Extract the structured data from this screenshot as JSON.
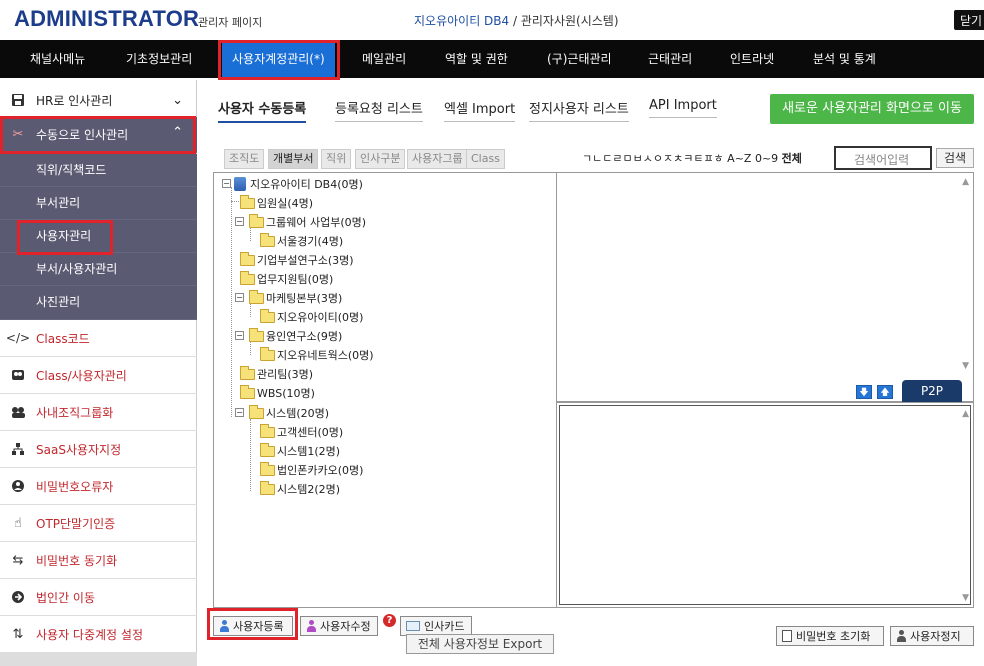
{
  "header": {
    "logo": "ADMINISTRATOR",
    "logo_sub": "관리자 페이지",
    "company": "지오유아이티 DB4",
    "separator": " / ",
    "user": "관리자사원(시스템)",
    "close_label": "닫기"
  },
  "topnav": {
    "items": [
      "채널사메뉴",
      "기초정보관리",
      "사용자계정관리(*)",
      "메일관리",
      "역할 및 권한",
      "(구)근태관리",
      "근태관리",
      "인트라넷",
      "분석 및 통계"
    ],
    "active_index": 2
  },
  "sidebar": {
    "hr": "HR로 인사관리",
    "manual": "수동으로 인사관리",
    "subitems": [
      "직위/직책코드",
      "부서관리",
      "사용자관리",
      "부서/사용자관리",
      "사진관리"
    ],
    "items": [
      {
        "label": "Class코드",
        "icon": "code-icon"
      },
      {
        "label": "Class/사용자관리",
        "icon": "users-icon"
      },
      {
        "label": "사내조직그룹화",
        "icon": "group-icon"
      },
      {
        "label": "SaaS사용자지정",
        "icon": "sitemap-icon"
      },
      {
        "label": "비밀번호오류자",
        "icon": "user-error-icon"
      },
      {
        "label": "OTP단말기인증",
        "icon": "hand-icon"
      },
      {
        "label": "비밀번호 동기화",
        "icon": "sync-icon"
      },
      {
        "label": "법인간 이동",
        "icon": "arrow-circle-icon"
      },
      {
        "label": "사용자 다중계정 설정",
        "icon": "switch-icon"
      }
    ]
  },
  "subtabs": [
    "사용자 수동등록",
    "등록요청 리스트",
    "엑셀 Import",
    "정지사용자 리스트",
    "API Import"
  ],
  "green_button": "새로운 사용자관리 화면으로 이동",
  "tree_tabs": [
    "조직도",
    "개별부서",
    "직위",
    "인사구분",
    "사용자그룹",
    "Class"
  ],
  "initials": "ㄱㄴㄷㄹㅁㅂㅅㅇㅈㅊㅋㅌㅍㅎ A~Z 0~9",
  "initials_all": "전체",
  "search": {
    "placeholder": "검색어입력",
    "button": "검색"
  },
  "tree": {
    "root": "지오유아이티 DB4(0명)",
    "nodes": [
      "임원실(4명)",
      "그룹웨어 사업부(0명)",
      "서울경기(4명)",
      "기업부설연구소(3명)",
      "업무지원팀(0명)",
      "마케팅본부(3명)",
      "지오유아이티(0명)",
      "융인연구소(9명)",
      "지오유네트웍스(0명)",
      "관리팀(3명)",
      "WBS(10명)",
      "시스템(20명)",
      "고객센터(0명)",
      "시스템1(2명)",
      "법인폰카카오(0명)",
      "시스템2(2명)"
    ]
  },
  "p2p": "P2P",
  "buttons": {
    "register": "사용자등록",
    "modify": "사용자수정",
    "card": "인사카드",
    "export": "전체 사용자정보 Export",
    "reset_pw": "비밀번호 초기화",
    "stop_user": "사용자정지"
  },
  "colors": {
    "nav_active": "#1a6fd6",
    "sidebar_dark": "#5a5a72",
    "green": "#4cb648",
    "highlight": "#e0232a",
    "logo": "#1c3c8c"
  }
}
